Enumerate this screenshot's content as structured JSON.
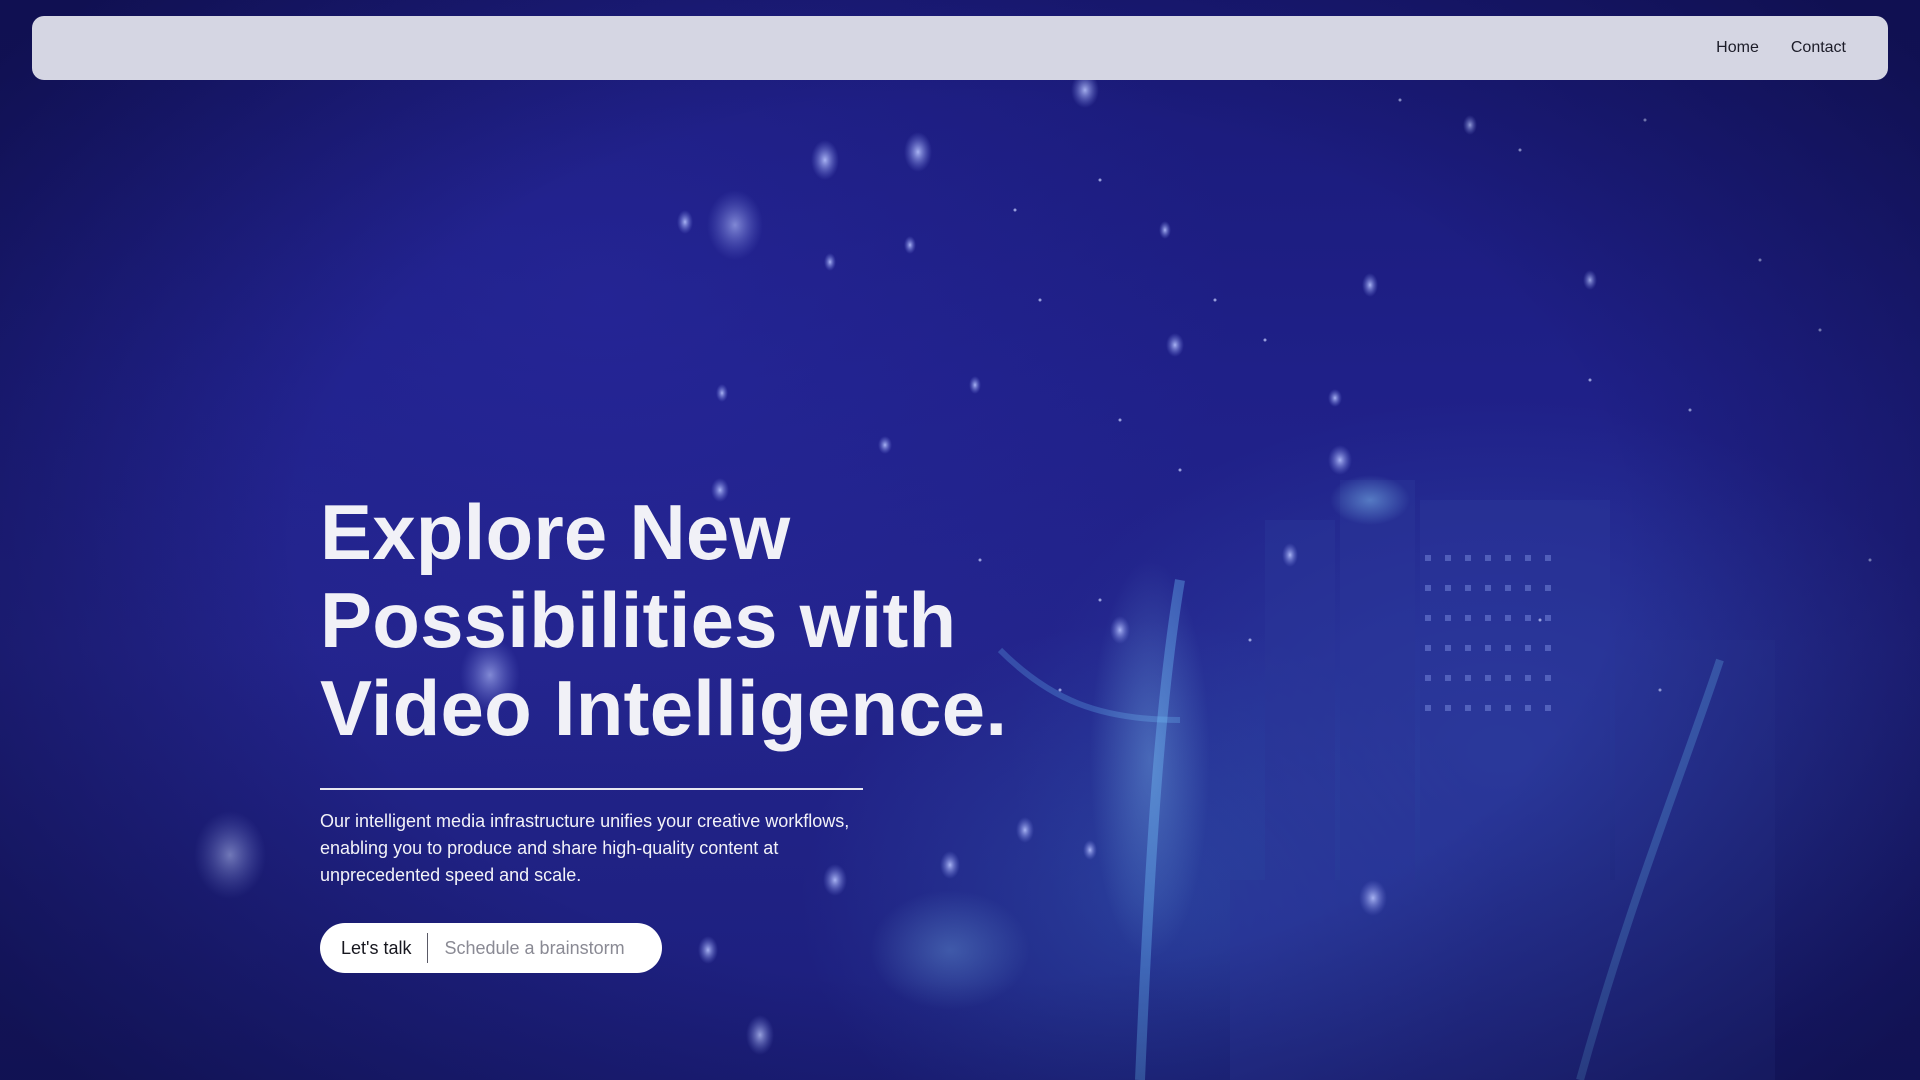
{
  "nav": {
    "links": [
      {
        "label": "Home"
      },
      {
        "label": "Contact"
      }
    ]
  },
  "hero": {
    "title_lines": [
      "Explore New",
      "Possibilities with",
      "Video Intelligence."
    ],
    "subtitle": "Our intelligent media infrastructure unifies your creative workflows, enabling you to produce and share high-quality content at unprecedented speed and scale.",
    "cta": {
      "primary_label": "Let's talk",
      "secondary_label": "Schedule a brainstorm"
    }
  },
  "colors": {
    "background": "#1f2088",
    "navbar": "#d5d6e3",
    "text_light": "#f1f1f7",
    "cta_bg": "#ffffff"
  }
}
